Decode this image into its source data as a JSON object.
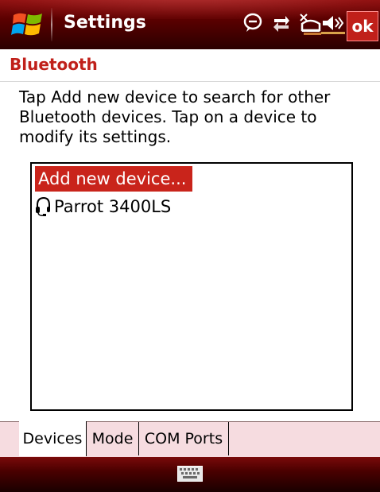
{
  "titlebar": {
    "title": "Settings",
    "ok_label": "ok",
    "status_icons": [
      "notification-icon",
      "connectivity-icon",
      "signal-icon",
      "volume-icon"
    ]
  },
  "section": {
    "title": "Bluetooth"
  },
  "instructions": "Tap Add new device to search for other Bluetooth devices. Tap on a device to modify its settings.",
  "device_list": {
    "items": [
      {
        "label": "Add new device...",
        "selected": true
      },
      {
        "label": "Parrot 3400LS",
        "icon": "headset-icon",
        "selected": false
      }
    ]
  },
  "tabs": [
    {
      "label": "Devices",
      "active": true
    },
    {
      "label": "Mode",
      "active": false
    },
    {
      "label": "COM Ports",
      "active": false
    }
  ],
  "menubar": {
    "input_icon": "keyboard-icon"
  },
  "colors": {
    "accent": "#c0201a",
    "titlebar": "#5a0000",
    "tab_background": "#f6dce0"
  }
}
